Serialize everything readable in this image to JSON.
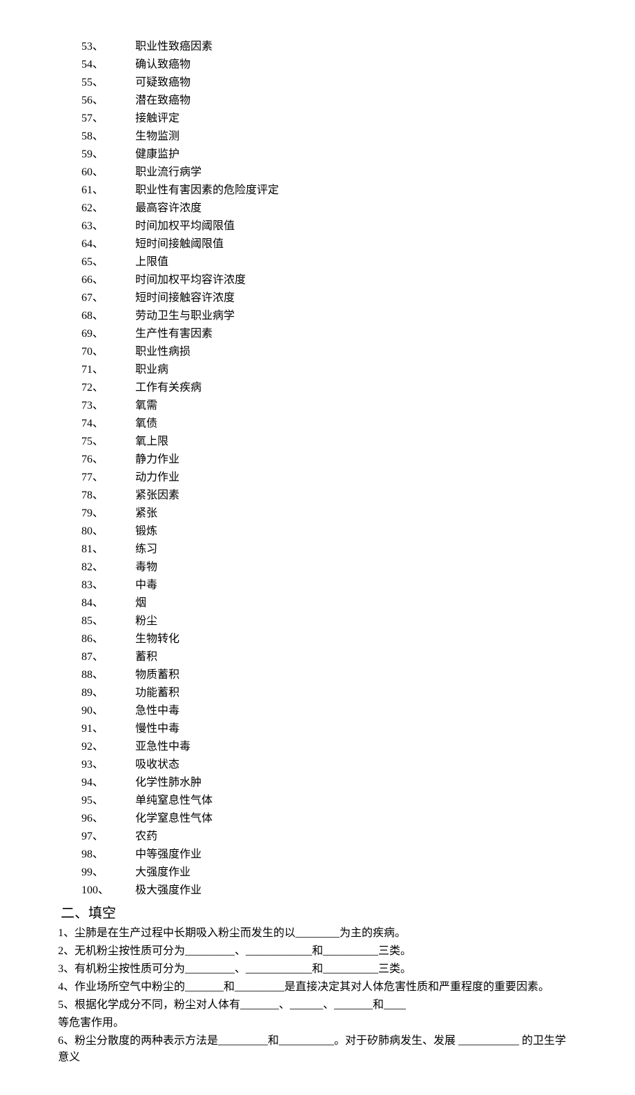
{
  "terms": [
    {
      "num": "53、",
      "text": "职业性致癌因素"
    },
    {
      "num": "54、",
      "text": "确认致癌物"
    },
    {
      "num": "55、",
      "text": "可疑致癌物"
    },
    {
      "num": "56、",
      "text": "潜在致癌物"
    },
    {
      "num": "57、",
      "text": "接触评定"
    },
    {
      "num": "58、",
      "text": "生物监测"
    },
    {
      "num": "59、",
      "text": "健康监护"
    },
    {
      "num": "60、",
      "text": "职业流行病学"
    },
    {
      "num": "61、",
      "text": "职业性有害因素的危险度评定"
    },
    {
      "num": "62、",
      "text": "最高容许浓度"
    },
    {
      "num": "63、",
      "text": "时间加权平均阈限值"
    },
    {
      "num": "64、",
      "text": "短时间接触阈限值"
    },
    {
      "num": "65、",
      "text": "上限值"
    },
    {
      "num": "66、",
      "text": "时间加权平均容许浓度"
    },
    {
      "num": "67、",
      "text": "短时间接触容许浓度"
    },
    {
      "num": "68、",
      "text": "劳动卫生与职业病学"
    },
    {
      "num": "69、",
      "text": "生产性有害因素"
    },
    {
      "num": "70、",
      "text": "职业性病损"
    },
    {
      "num": "71、",
      "text": "职业病"
    },
    {
      "num": "72、",
      "text": "工作有关疾病"
    },
    {
      "num": "73、",
      "text": "氧需"
    },
    {
      "num": "74、",
      "text": "氧债"
    },
    {
      "num": "75、",
      "text": "氧上限"
    },
    {
      "num": "76、",
      "text": "静力作业"
    },
    {
      "num": "77、",
      "text": "动力作业"
    },
    {
      "num": "78、",
      "text": "紧张因素"
    },
    {
      "num": "79、",
      "text": "紧张"
    },
    {
      "num": "80、",
      "text": "锻炼"
    },
    {
      "num": "81、",
      "text": "练习"
    },
    {
      "num": "82、",
      "text": "毒物"
    },
    {
      "num": "83、",
      "text": "中毒"
    },
    {
      "num": "84、",
      "text": "烟"
    },
    {
      "num": "85、",
      "text": "粉尘"
    },
    {
      "num": "86、",
      "text": "生物转化"
    },
    {
      "num": "87、",
      "text": "蓄积"
    },
    {
      "num": "88、",
      "text": "物质蓄积"
    },
    {
      "num": "89、",
      "text": "功能蓄积"
    },
    {
      "num": "90、",
      "text": "急性中毒"
    },
    {
      "num": "91、",
      "text": "慢性中毒"
    },
    {
      "num": "92、",
      "text": "亚急性中毒"
    },
    {
      "num": "93、",
      "text": "吸收状态"
    },
    {
      "num": "94、",
      "text": "化学性肺水肿"
    },
    {
      "num": "95、",
      "text": "单纯窒息性气体"
    },
    {
      "num": "96、",
      "text": "化学窒息性气体"
    },
    {
      "num": "97、",
      "text": "农药"
    },
    {
      "num": "98、",
      "text": "中等强度作业"
    },
    {
      "num": "99、",
      "text": "大强度作业"
    },
    {
      "num": "100、",
      "text": "极大强度作业"
    }
  ],
  "section2": {
    "heading": "二、填空",
    "items": [
      "1、尘肺是在生产过程中长期吸入粉尘而发生的以________为主的疾病。",
      "2、无机粉尘按性质可分为_________、____________和__________三类。",
      "3、有机粉尘按性质可分为_________、____________和__________三类。",
      "4、作业场所空气中粉尘的_______和_________是直接决定其对人体危害性质和严重程度的重要因素。",
      "5、根据化学成分不同，粉尘对人体有_______、______、_______和____",
      "等危害作用。",
      "6、粉尘分散度的两种表示方法是_________和__________。对于矽肺病发生、发展 ___________ 的卫生学意义"
    ]
  }
}
